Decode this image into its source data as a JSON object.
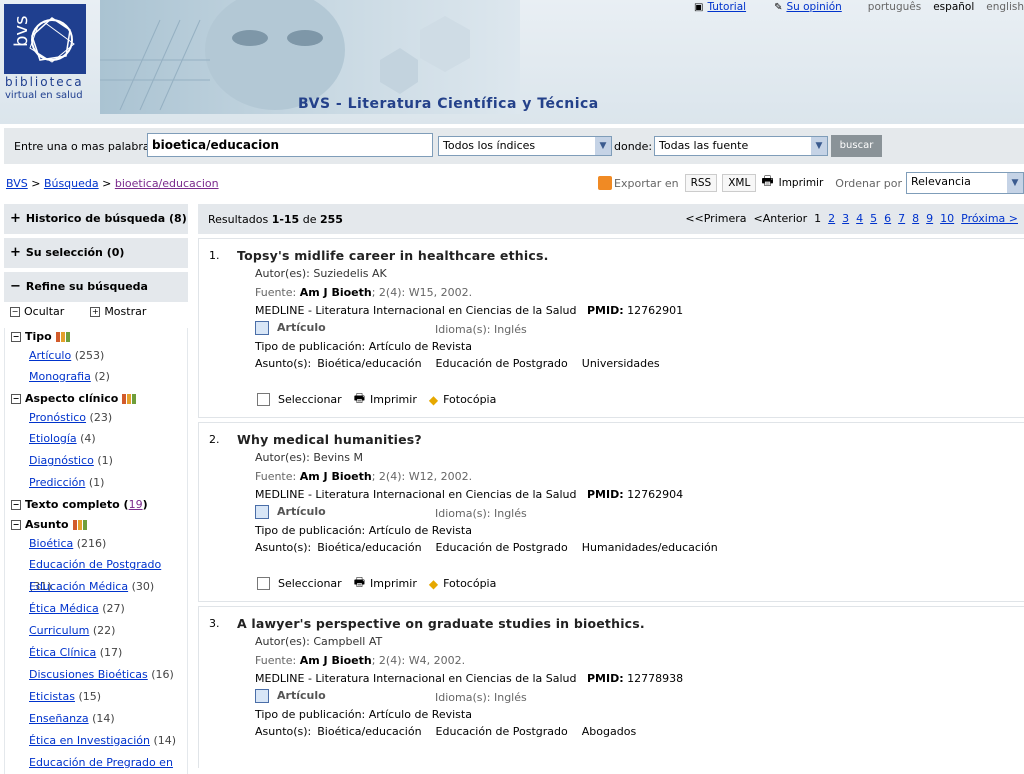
{
  "header": {
    "logo_acronym": "bvs",
    "logo_line1": "biblioteca",
    "logo_line2": "virtual en salud",
    "title": "BVS - Literatura Científica y Técnica",
    "tutorial_link": "Tutorial",
    "opinion_link": "Su opinión",
    "languages": [
      "português",
      "español",
      "english"
    ]
  },
  "search": {
    "label": "Entre una o mas palabras",
    "query": "bioetica/educacion",
    "index_select": "Todos los índices",
    "where_label": "donde:",
    "source_select": "Todas las fuente",
    "submit_label": "buscar"
  },
  "breadcrumb": {
    "items": [
      "BVS",
      "Búsqueda",
      "bioetica/educacion"
    ],
    "separator": ">"
  },
  "toolbar": {
    "export_label": "Exportar en",
    "rss": "RSS",
    "xml": "XML",
    "print": "Imprimir",
    "order_label": "Ordenar por",
    "order_value": "Relevancia"
  },
  "sidebar": {
    "history": "Historico de búsqueda",
    "history_count": "(8)",
    "selection": "Su selección",
    "selection_count": "(0)",
    "refine": "Refine su búsqueda",
    "hide": "Ocultar",
    "show": "Mostrar",
    "tipo": {
      "label": "Tipo",
      "items": [
        {
          "name": "Artículo",
          "count": "(253)"
        },
        {
          "name": "Monografia",
          "count": "(2)"
        }
      ]
    },
    "aspecto": {
      "label": "Aspecto clínico",
      "items": [
        {
          "name": "Pronóstico",
          "count": "(23)"
        },
        {
          "name": "Etiología",
          "count": "(4)"
        },
        {
          "name": "Diagnóstico",
          "count": "(1)"
        },
        {
          "name": "Predicción",
          "count": "(1)"
        }
      ]
    },
    "texto": {
      "label": "Texto completo",
      "open": "(",
      "count": "19",
      "close": ")"
    },
    "asunto": {
      "label": "Asunto",
      "items": [
        {
          "name": "Bioética",
          "count": "(216)"
        },
        {
          "name": "Educación de Postgrado",
          "count": "(31)"
        },
        {
          "name": "Educación Médica",
          "count": "(30)"
        },
        {
          "name": "Ética Médica",
          "count": "(27)"
        },
        {
          "name": "Curriculum",
          "count": "(22)"
        },
        {
          "name": "Ética Clínica",
          "count": "(17)"
        },
        {
          "name": "Discusiones Bioéticas",
          "count": "(16)"
        },
        {
          "name": "Eticistas",
          "count": "(15)"
        },
        {
          "name": "Enseñanza",
          "count": "(14)"
        },
        {
          "name": "Ética en Investigación",
          "count": "(14)"
        },
        {
          "name": "Educación de Pregrado en",
          "count": ""
        }
      ]
    }
  },
  "results_bar": {
    "label": "Resultados",
    "range": "1-15",
    "of": "de",
    "total": "255",
    "first": "<<Primera",
    "prev": "<Anterior",
    "pages": [
      "1",
      "2",
      "3",
      "4",
      "5",
      "6",
      "7",
      "8",
      "9",
      "10"
    ],
    "next": "Próxima >"
  },
  "result_labels": {
    "authors": "Autor(es):",
    "source": "Fuente:",
    "pmid": "PMID:",
    "article": "Artículo",
    "language": "Idioma(s): Inglés",
    "pubtype": "Tipo de publicación: Artículo de Revista",
    "subjects": "Asunto(s):",
    "select": "Seleccionar",
    "print": "Imprimir",
    "photocopy": "Fotocópia"
  },
  "results": [
    {
      "num": "1.",
      "title": "Topsy's midlife career in healthcare ethics.",
      "authors": "Suziedelis AK",
      "journal": "Am J Bioeth",
      "details": "; 2(4): W15, 2002.",
      "db": "MEDLINE - Literatura Internacional en Ciencias de la Salud",
      "pmid": "12762901",
      "subjects": [
        "Bioética/educación",
        "Educación de Postgrado",
        "Universidades"
      ]
    },
    {
      "num": "2.",
      "title": "Why medical humanities?",
      "authors": "Bevins M",
      "journal": "Am J Bioeth",
      "details": "; 2(4): W12, 2002.",
      "db": "MEDLINE - Literatura Internacional en Ciencias de la Salud",
      "pmid": "12762904",
      "subjects": [
        "Bioética/educación",
        "Educación de Postgrado",
        "Humanidades/educación"
      ]
    },
    {
      "num": "3.",
      "title": "A lawyer's perspective on graduate studies in bioethics.",
      "authors": "Campbell AT",
      "journal": "Am J Bioeth",
      "details": "; 2(4): W4, 2002.",
      "db": "MEDLINE - Literatura Internacional en Ciencias de la Salud",
      "pmid": "12778938",
      "subjects": [
        "Bioética/educación",
        "Educación de Postgrado",
        "Abogados"
      ]
    }
  ]
}
